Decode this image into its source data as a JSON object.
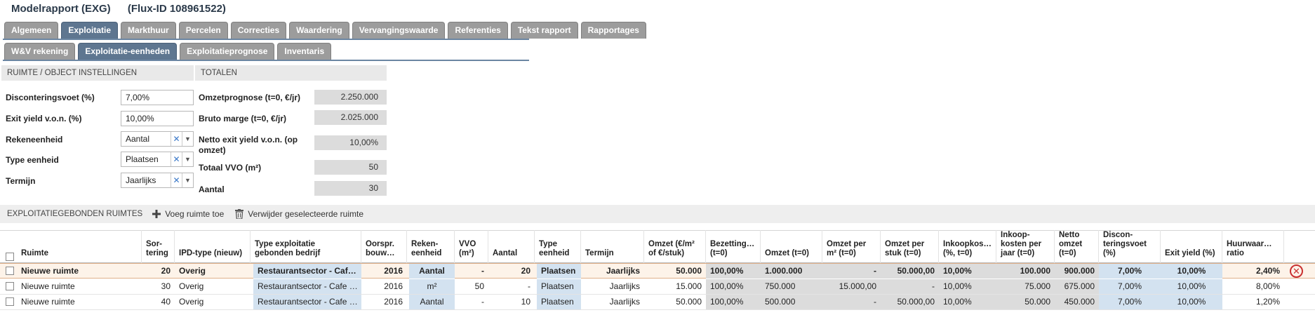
{
  "header": {
    "title": "Modelrapport (EXG)",
    "flux": "(Flux-ID 108961522)"
  },
  "tabs_row1": [
    "Algemeen",
    "Exploitatie",
    "Markthuur",
    "Percelen",
    "Correcties",
    "Waardering",
    "Vervangingswaarde",
    "Referenties",
    "Tekst rapport",
    "Rapportages"
  ],
  "tabs_row2": [
    "W&V rekening",
    "Exploitatie-eenheden",
    "Exploitatieprognose",
    "Inventaris"
  ],
  "settings": {
    "header": "RUIMTE / OBJECT INSTELLINGEN",
    "disconteringsvoet_label": "Disconteringsvoet (%)",
    "disconteringsvoet_value": "7,00%",
    "exit_yield_label": "Exit yield v.o.n. (%)",
    "exit_yield_value": "10,00%",
    "rekeneenheid_label": "Rekeneenheid",
    "rekeneenheid_value": "Aantal",
    "type_eenheid_label": "Type eenheid",
    "type_eenheid_value": "Plaatsen",
    "termijn_label": "Termijn",
    "termijn_value": "Jaarlijks"
  },
  "totalen": {
    "header": "TOTALEN",
    "omzetprognose_label": "Omzetprognose (t=0, €/jr)",
    "omzetprognose_value": "2.250.000",
    "bruto_marge_label": "Bruto marge (t=0, €/jr)",
    "bruto_marge_value": "2.025.000",
    "netto_exit_label": "Netto exit yield v.o.n. (op omzet)",
    "netto_exit_value": "10,00%",
    "totaal_vvo_label": "Totaal VVO (m²)",
    "totaal_vvo_value": "50",
    "aantal_label": "Aantal",
    "aantal_value": "30"
  },
  "toolbar": {
    "title": "EXPLOITATIEGEBONDEN RUIMTES",
    "add_label": "Voeg ruimte toe",
    "delete_label": "Verwijder geselecteerde ruimte"
  },
  "table": {
    "headers": {
      "ruimte": "Ruimte",
      "sort1": "Sor-",
      "sort2": "tering",
      "ipd": "IPD-type (nieuw)",
      "type1": "Type exploitatie",
      "type2": "gebonden bedrijf",
      "oorspr1": "Oorspr.",
      "oorspr2": "bouw…",
      "reken1": "Reken-",
      "reken2": "eenheid",
      "vvo1": "VVO",
      "vvo2": "(m²)",
      "aantal": "Aantal",
      "typee1": "Type",
      "typee2": "eenheid",
      "termijn": "Termijn",
      "omzet1": "Omzet (€/m²",
      "omzet2": "of €/stuk)",
      "bez1": "Bezetting…",
      "bez2": "(t=0)",
      "omzett0": "Omzet (t=0)",
      "omzetm1": "Omzet per",
      "omzetm2": "m² (t=0)",
      "omzets1": "Omzet per",
      "omzets2": "stuk (t=0)",
      "ink1": "Inkoopkos…",
      "ink2": "(%, t=0)",
      "inkj1": "Inkoop-",
      "inkj2": "kosten per",
      "inkj3": "jaar (t=0)",
      "netto1": "Netto",
      "netto2": "omzet",
      "netto3": "(t=0)",
      "disc1": "Discon-",
      "disc2": "teringsvoet",
      "disc3": "(%)",
      "exit": "Exit yield (%)",
      "huur1": "Huurwaar…",
      "huur2": "ratio"
    },
    "rows": [
      {
        "ruimte": "Nieuwe ruimte",
        "sort": "20",
        "ipd": "Overig",
        "type": "Restaurantsector - Caf…",
        "bouw": "2016",
        "reken": "Aantal",
        "vvo": "-",
        "aantal": "20",
        "typee": "Plaatsen",
        "termijn": "Jaarlijks",
        "omzet": "50.000",
        "bez": "100,00%",
        "omzett0": "1.000.000",
        "omzetm": "-",
        "omzets": "50.000,00",
        "ink": "10,00%",
        "inkj": "100.000",
        "netto": "900.000",
        "disc": "7,00%",
        "exit": "10,00%",
        "huur": "2,40%"
      },
      {
        "ruimte": "Nieuwe ruimte",
        "sort": "30",
        "ipd": "Overig",
        "type": "Restaurantsector - Cafe …",
        "bouw": "2016",
        "reken": "m²",
        "vvo": "50",
        "aantal": "-",
        "typee": "Plaatsen",
        "termijn": "Jaarlijks",
        "omzet": "15.000",
        "bez": "100,00%",
        "omzett0": "750.000",
        "omzetm": "15.000,00",
        "omzets": "-",
        "ink": "10,00%",
        "inkj": "75.000",
        "netto": "675.000",
        "disc": "7,00%",
        "exit": "10,00%",
        "huur": "8,00%"
      },
      {
        "ruimte": "Nieuwe ruimte",
        "sort": "40",
        "ipd": "Overig",
        "type": "Restaurantsector - Cafe …",
        "bouw": "2016",
        "reken": "Aantal",
        "vvo": "-",
        "aantal": "10",
        "typee": "Plaatsen",
        "termijn": "Jaarlijks",
        "omzet": "50.000",
        "bez": "100,00%",
        "omzett0": "500.000",
        "omzetm": "-",
        "omzets": "50.000,00",
        "ink": "10,00%",
        "inkj": "50.000",
        "netto": "450.000",
        "disc": "7,00%",
        "exit": "10,00%",
        "huur": "1,20%"
      }
    ]
  }
}
